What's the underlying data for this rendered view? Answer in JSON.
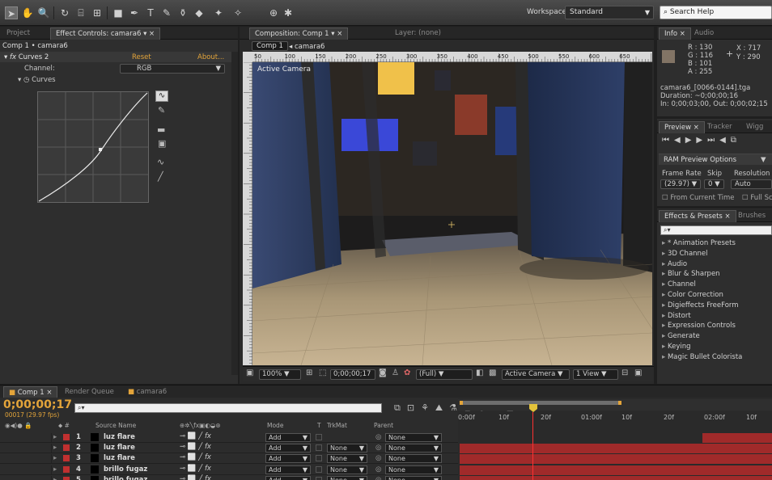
{
  "toolbar": {
    "workspace_label": "Workspace:",
    "workspace_value": "Standard",
    "search_placeholder": "Search Help"
  },
  "left_panel": {
    "tab_project": "Project",
    "tab_effect": "Effect Controls: camara6",
    "breadcrumb": "Comp 1 • camara6",
    "effect_name": "Curves 2",
    "reset": "Reset",
    "about": "About...",
    "channel_label": "Channel:",
    "channel_value": "RGB",
    "curves_label": "Curves"
  },
  "composition": {
    "tab_label": "Composition: Comp 1",
    "layer_tab": "Layer: (none)",
    "crumb_comp": "Comp 1",
    "crumb_layer": "camara6",
    "view_label": "Active Camera",
    "ruler_ticks": [
      "50",
      "100",
      "150",
      "200",
      "250",
      "300",
      "350",
      "400",
      "450",
      "500",
      "550",
      "600",
      "650"
    ],
    "zoom": "100%",
    "timecode": "0;00;00;17",
    "resolution": "(Full)",
    "camera": "Active Camera",
    "views": "1 View"
  },
  "info": {
    "tab_info": "Info",
    "tab_audio": "Audio",
    "r": "R : 130",
    "g": "G : 116",
    "b": "B : 101",
    "a": "A : 255",
    "x": "X : 717",
    "y": "Y : 290",
    "swatch": "#827465",
    "file": "camara6_[0066-0144].tga",
    "duration": "Duration: ~0;00;00;16",
    "inout": "In: 0;00;03;00, Out: 0;00;02;15"
  },
  "preview": {
    "tab_preview": "Preview",
    "tab_tracker": "Tracker",
    "tab_wiggler": "Wigg",
    "ram_options": "RAM Preview Options",
    "frame_rate_label": "Frame Rate",
    "skip_label": "Skip",
    "resolution_label": "Resolution",
    "frame_rate": "(29.97)",
    "skip": "0",
    "resolution": "Auto",
    "from_current": "From Current Time",
    "full_screen": "Full Sc"
  },
  "effects": {
    "tab_effects": "Effects & Presets",
    "tab_brushes": "Brushes",
    "items": [
      "* Animation Presets",
      "3D Channel",
      "Audio",
      "Blur & Sharpen",
      "Channel",
      "Color Correction",
      "Digieffects FreeForm",
      "Distort",
      "Expression Controls",
      "Generate",
      "Keying",
      "Magic Bullet Colorista"
    ]
  },
  "timeline": {
    "tab_comp": "Comp 1",
    "tab_render": "Render Queue",
    "tab_camara": "camara6",
    "timecode": "0;00;00;17",
    "fps": "00017 (29.97 fps)",
    "search_placeholder": "",
    "col_source": "Source Name",
    "col_mode": "Mode",
    "col_t": "T",
    "col_trkmat": "TrkMat",
    "col_parent": "Parent",
    "ruler": [
      "0:00f",
      "10f",
      "20f",
      "01:00f",
      "10f",
      "20f",
      "02:00f",
      "10f"
    ],
    "layers": [
      {
        "num": "1",
        "name": "luz flare",
        "mode": "Add",
        "trkmat": "",
        "parent": "None"
      },
      {
        "num": "2",
        "name": "luz flare",
        "mode": "Add",
        "trkmat": "None",
        "parent": "None"
      },
      {
        "num": "3",
        "name": "luz flare",
        "mode": "Add",
        "trkmat": "None",
        "parent": "None"
      },
      {
        "num": "4",
        "name": "brillo fugaz",
        "mode": "Add",
        "trkmat": "None",
        "parent": "None"
      },
      {
        "num": "5",
        "name": "brillo fugaz",
        "mode": "Add",
        "trkmat": "None",
        "parent": "None"
      }
    ]
  }
}
